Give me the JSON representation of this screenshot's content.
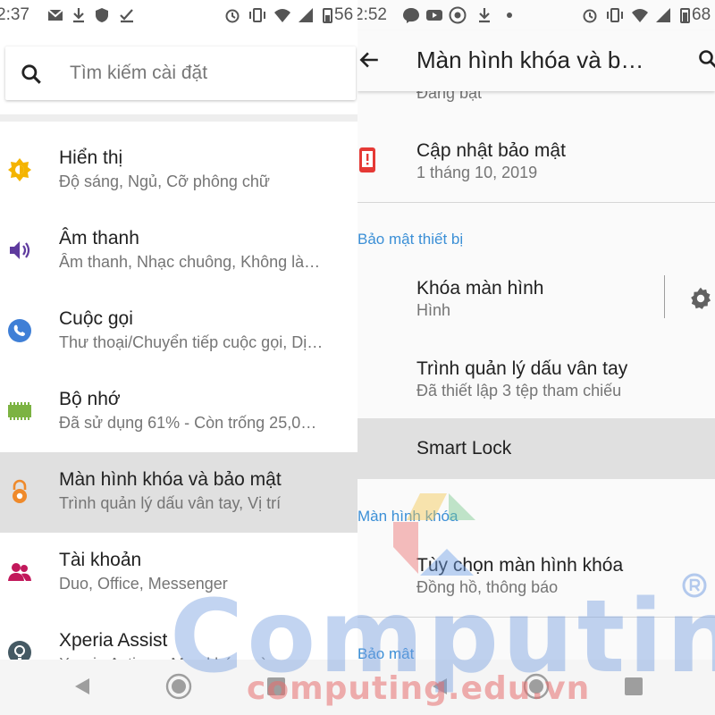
{
  "left": {
    "status": {
      "time": "2:37",
      "battery": "56"
    },
    "search": {
      "placeholder": "Tìm kiếm cài đặt"
    },
    "items": [
      {
        "title": "Hiển thị",
        "subtitle": "Độ sáng, Ngủ, Cỡ phông chữ",
        "icon": "display-brightness-icon",
        "color": "#f4b400"
      },
      {
        "title": "Âm thanh",
        "subtitle": "Âm thanh, Nhạc chuông, Không là…",
        "icon": "volume-icon",
        "color": "#5e3a9e"
      },
      {
        "title": "Cuộc gọi",
        "subtitle": "Thư thoại/Chuyển tiếp cuộc gọi, Dị…",
        "icon": "phone-icon",
        "color": "#3f7fd6"
      },
      {
        "title": "Bộ nhớ",
        "subtitle": "Đã sử dụng 61% - Còn trống 25,0…",
        "icon": "memory-chip-icon",
        "color": "#7cb342"
      },
      {
        "title": "Màn hình khóa và bảo mật",
        "subtitle": "Trình quản lý dấu vân tay, Vị trí",
        "icon": "lock-icon",
        "color": "#ef8a2b"
      },
      {
        "title": "Tài khoản",
        "subtitle": "Duo, Office, Messenger",
        "icon": "account-icon",
        "color": "#c2185b"
      },
      {
        "title": "Xperia Assist",
        "subtitle": "Xperia Actions, Mẹo khóa màn…",
        "icon": "lightbulb-icon",
        "color": "#455a64"
      }
    ]
  },
  "right": {
    "status": {
      "time": "2:52",
      "battery": "68"
    },
    "toolbar_title": "Màn hình khóa và b…",
    "top_partial": "Đang bật",
    "security_update": {
      "title": "Cập nhật bảo mật",
      "subtitle": "1 tháng 10, 2019"
    },
    "section_device_security": "Bảo mật thiết bị",
    "screen_lock": {
      "title": "Khóa màn hình",
      "subtitle": "Hình"
    },
    "fingerprint": {
      "title": "Trình quản lý dấu vân tay",
      "subtitle": "Đã thiết lập 3 tệp tham chiếu"
    },
    "smart_lock": {
      "title": "Smart Lock"
    },
    "section_lock_screen": "Màn hình khóa",
    "lock_options": {
      "title": "Tùy chọn màn hình khóa",
      "subtitle": "Đồng hồ, thông báo"
    },
    "section_security": "Bảo mật"
  },
  "watermark": {
    "big": "Computing",
    "small": "computing.edu.vn"
  },
  "colors": {
    "section_blue": "#3b8fd6",
    "selected_bg": "#e0e0e0"
  }
}
